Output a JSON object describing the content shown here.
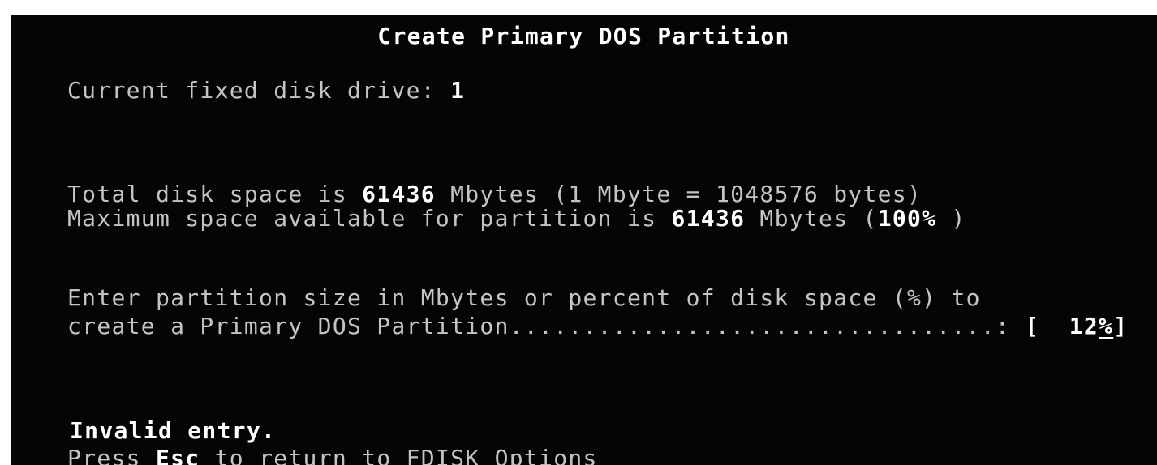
{
  "screen_title": "Create Primary DOS Partition",
  "drive": {
    "label": "Current fixed disk drive: ",
    "value": "1"
  },
  "disk_info": {
    "total_prefix": "Total disk space is ",
    "total_value": "61436",
    "total_suffix": " Mbytes (1 Mbyte = 1048576 bytes)",
    "max_prefix": "Maximum space available for partition is ",
    "max_value": "61436",
    "max_middle": " Mbytes (",
    "max_percent": "100%",
    "max_suffix": " )"
  },
  "prompt": {
    "line1": "Enter partition size in Mbytes or percent of disk space (%) to",
    "line2": "create a Primary DOS Partition.................................: ",
    "open_bracket": "[",
    "input_value": "  12",
    "input_cursor_char": "%",
    "close_bracket": "]"
  },
  "status": {
    "error_message": "Invalid entry.",
    "esc_prefix": "Press ",
    "esc_key": "Esc",
    "esc_suffix": " to return to FDISK Options"
  }
}
